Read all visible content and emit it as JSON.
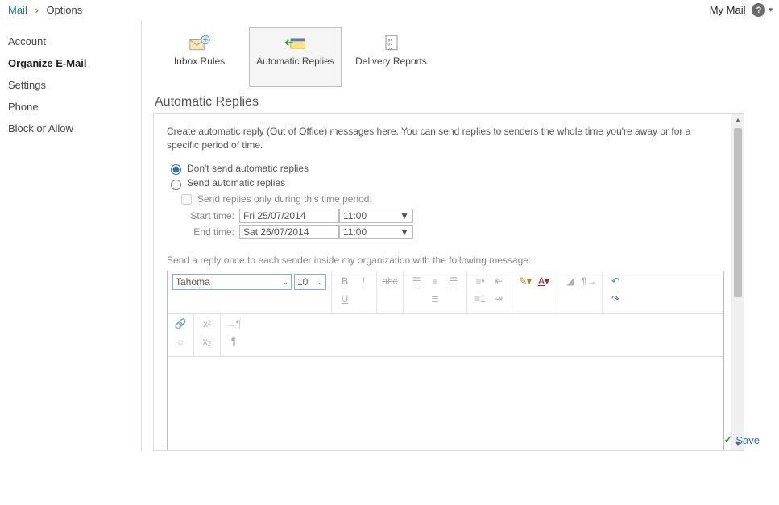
{
  "breadcrumb": {
    "root": "Mail",
    "current": "Options"
  },
  "top_right": {
    "label": "My Mail"
  },
  "sidebar": {
    "items": [
      {
        "label": "Account"
      },
      {
        "label": "Organize E-Mail"
      },
      {
        "label": "Settings"
      },
      {
        "label": "Phone"
      },
      {
        "label": "Block or Allow"
      }
    ],
    "active_index": 1
  },
  "ribbon": {
    "items": [
      {
        "label": "Inbox Rules"
      },
      {
        "label": "Automatic Replies"
      },
      {
        "label": "Delivery Reports"
      }
    ],
    "active_index": 1
  },
  "section": {
    "title": "Automatic Replies",
    "intro": "Create automatic reply (Out of Office) messages here. You can send replies to senders the whole time you're away or for a specific period of time.",
    "radio_dont": "Don't send automatic replies",
    "radio_send": "Send automatic replies",
    "selected_radio": "dont",
    "check_period": "Send replies only during this time period:",
    "start_label": "Start time:",
    "end_label": "End time:",
    "start_date": "Fri 25/07/2014",
    "start_time": "11:00",
    "end_date": "Sat 26/07/2014",
    "end_time": "11:00",
    "reply_label": "Send a reply once to each sender inside my organization with the following message:"
  },
  "editor": {
    "font_name": "Tahoma",
    "font_size": "10"
  },
  "footer": {
    "save": "Save"
  }
}
